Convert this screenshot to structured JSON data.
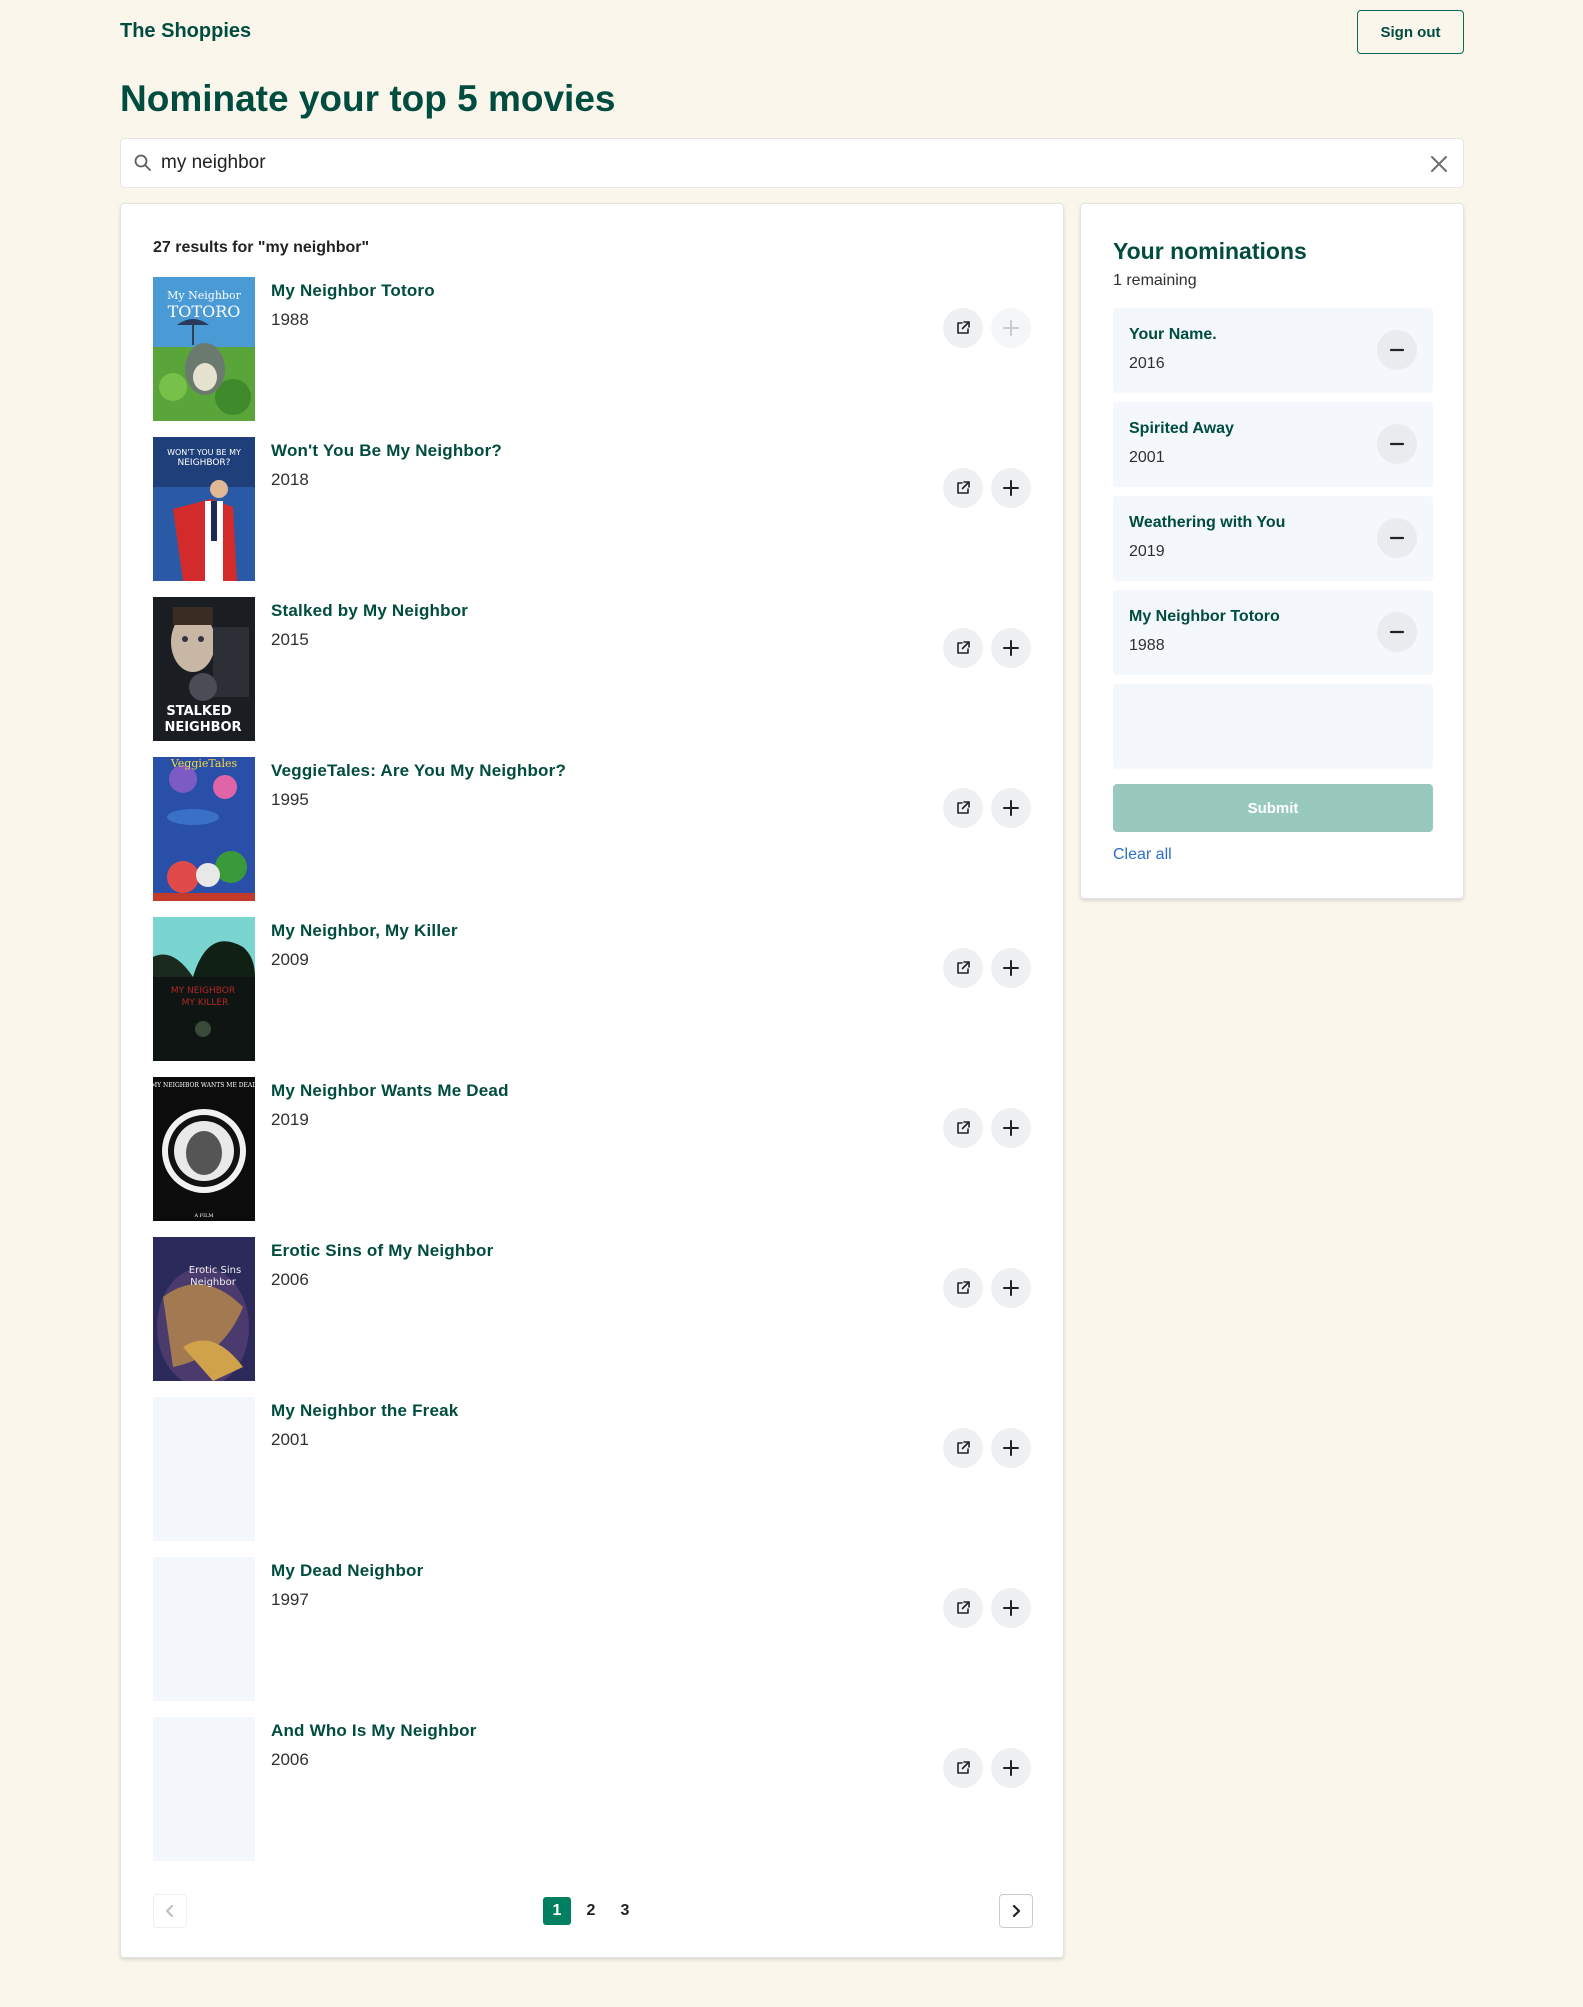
{
  "header": {
    "brand": "The Shoppies",
    "signout_label": "Sign out"
  },
  "page_title": "Nominate your top 5 movies",
  "search": {
    "value": "my neighbor",
    "placeholder": "Search movies"
  },
  "results": {
    "summary": "27 results for \"my neighbor\"",
    "items": [
      {
        "title": "My Neighbor Totoro",
        "year": "1988",
        "poster": "poster",
        "nominated": true
      },
      {
        "title": "Won't You Be My Neighbor?",
        "year": "2018",
        "poster": "poster",
        "nominated": false
      },
      {
        "title": "Stalked by My Neighbor",
        "year": "2015",
        "poster": "poster",
        "nominated": false
      },
      {
        "title": "VeggieTales: Are You My Neighbor?",
        "year": "1995",
        "poster": "poster",
        "nominated": false
      },
      {
        "title": "My Neighbor, My Killer",
        "year": "2009",
        "poster": "poster",
        "nominated": false
      },
      {
        "title": "My Neighbor Wants Me Dead",
        "year": "2019",
        "poster": "poster",
        "nominated": false
      },
      {
        "title": "Erotic Sins of My Neighbor",
        "year": "2006",
        "poster": "poster",
        "nominated": false
      },
      {
        "title": "My Neighbor the Freak",
        "year": "2001",
        "poster": "none",
        "nominated": false
      },
      {
        "title": "My Dead Neighbor",
        "year": "1997",
        "poster": "none",
        "nominated": false
      },
      {
        "title": "And Who Is My Neighbor",
        "year": "2006",
        "poster": "none",
        "nominated": false
      }
    ],
    "pagination": {
      "pages": [
        "1",
        "2",
        "3"
      ],
      "current": "1"
    }
  },
  "nominations": {
    "title": "Your nominations",
    "remaining": "1 remaining",
    "items": [
      {
        "title": "Your Name.",
        "year": "2016"
      },
      {
        "title": "Spirited Away",
        "year": "2001"
      },
      {
        "title": "Weathering with You",
        "year": "2019"
      },
      {
        "title": "My Neighbor Totoro",
        "year": "1988"
      }
    ],
    "submit_label": "Submit",
    "clear_label": "Clear all"
  },
  "colors": {
    "background": "#faf6ec",
    "brand_green": "#004c3f",
    "accent_green": "#008060",
    "submit_disabled": "#99c9bc",
    "link_blue": "#2c6ecb",
    "slot_bg": "#f4f7fb"
  },
  "icons": {
    "search": "search-icon",
    "clear": "close-icon",
    "external": "external-link-icon",
    "add": "plus-icon",
    "remove": "minus-icon",
    "prev": "chevron-left-icon",
    "next": "chevron-right-icon"
  }
}
